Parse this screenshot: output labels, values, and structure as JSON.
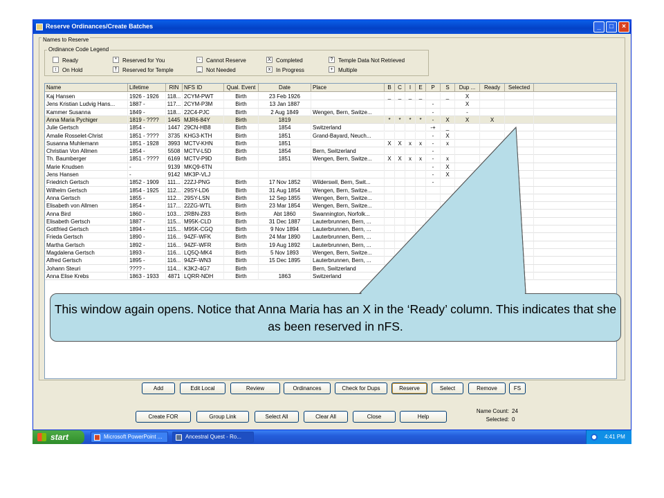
{
  "window": {
    "title": "Reserve Ordinances/Create Batches",
    "minimize": "_",
    "maximize": "□",
    "close": "×"
  },
  "group_label": "Names to Reserve",
  "legend": {
    "title": "Ordinance Code Legend",
    "items": [
      {
        "code": "",
        "label": "Ready"
      },
      {
        "code": "*",
        "label": "Reserved for You"
      },
      {
        "code": "-",
        "label": "Cannot Reserve"
      },
      {
        "code": "X",
        "label": "Completed"
      },
      {
        "code": "?",
        "label": "Temple Data Not Retrieved"
      },
      {
        "code": "↕",
        "label": "On Hold"
      },
      {
        "code": "†",
        "label": "Reserved for Temple"
      },
      {
        "code": "_",
        "label": "Not Needed"
      },
      {
        "code": "x",
        "label": "In Progress"
      },
      {
        "code": "+",
        "label": "Multiple"
      }
    ]
  },
  "columns": [
    "Name",
    "Lifetime",
    "RIN",
    "NFS ID",
    "Qual. Event",
    "Date",
    "Place",
    "B",
    "C",
    "I",
    "E",
    "P",
    "S",
    "Dup ...",
    "Ready",
    "Selected"
  ],
  "rows": [
    [
      "Kaj Hansen",
      "1926 - 1926",
      "118...",
      "2CYM-PWT",
      "Birth",
      "23 Feb 1926",
      "",
      "_",
      "_",
      "_",
      "_",
      "",
      "_",
      "X",
      "",
      ""
    ],
    [
      "Jens Kristian Ludvig Hans...",
      "1887 -",
      "117...",
      "2CYM-P3M",
      "Birth",
      "13 Jan 1887",
      "",
      "",
      "",
      "",
      "",
      "-",
      "",
      "X",
      "",
      ""
    ],
    [
      "Kammer Susanna",
      "1849 -",
      "118...",
      "22C4-PJC",
      "Birth",
      "2 Aug 1849",
      "Wengen, Bern, Switze...",
      "",
      "",
      "",
      "",
      "-",
      "",
      "-",
      "",
      ""
    ],
    [
      "Anna Maria Pychiger",
      "1819 - ????",
      "1445",
      "MJR6-84Y",
      "Birth",
      "1819",
      "",
      "*",
      "*",
      "*",
      "*",
      "-",
      "X",
      "X",
      "X",
      ""
    ],
    [
      "Julie Gertsch",
      "1854 -",
      "1447",
      "29CN-HB8",
      "Birth",
      "1854",
      "Switzerland",
      "",
      "",
      "",
      "",
      "-+",
      "_",
      "",
      "",
      ""
    ],
    [
      "Amalie Rosselet-Christ",
      "1851 - ????",
      "3735",
      "KHG3-KTH",
      "Birth",
      "1851",
      "Grand-Bayard, Neuch...",
      "",
      "",
      "",
      "",
      "-",
      "X",
      "",
      "",
      ""
    ],
    [
      "Susanna Muhlemann",
      "1851 - 1928",
      "3993",
      "MCTV-KHN",
      "Birth",
      "1851",
      "",
      "X",
      "X",
      "x",
      "x",
      "-",
      "x",
      "",
      "",
      ""
    ],
    [
      "Christian Von Allmen",
      "1854 -",
      "5508",
      "MCTV-L5D",
      "Birth",
      "1854",
      "Bern, Switzerland",
      "",
      "",
      "",
      "",
      "-",
      "",
      "",
      "",
      ""
    ],
    [
      "Th. Baumberger",
      "1851 - ????",
      "6169",
      "MCTV-P9D",
      "Birth",
      "1851",
      "Wengen, Bern, Switze...",
      "X",
      "X",
      "x",
      "x",
      "-",
      "x",
      "",
      "",
      ""
    ],
    [
      "Marie Knudsen",
      "-",
      "9139",
      "MKQ9-6TN",
      "",
      "",
      "",
      "",
      "",
      "",
      "",
      "-",
      "X",
      "",
      "",
      ""
    ],
    [
      "Jens Hansen",
      "-",
      "9142",
      "MK3P-VLJ",
      "",
      "",
      "",
      "",
      "",
      "",
      "",
      "-",
      "X",
      "",
      "",
      ""
    ],
    [
      "Friedrich Gertsch",
      "1852 - 1909",
      "111...",
      "22ZJ-PNG",
      "Birth",
      "17 Nov 1852",
      "Wilderswil, Bern, Swit...",
      "",
      "",
      "",
      "",
      "-",
      "",
      "",
      "",
      ""
    ],
    [
      "Wilhelm Gertsch",
      "1854 - 1925",
      "112...",
      "29SY-LD6",
      "Birth",
      "31 Aug 1854",
      "Wengen, Bern, Switze...",
      "",
      "",
      "",
      "",
      "",
      "",
      "",
      "",
      ""
    ],
    [
      "Anna Gertsch",
      "1855 -",
      "112...",
      "29SY-LSN",
      "Birth",
      "12 Sep 1855",
      "Wengen, Bern, Switze...",
      "",
      "",
      "",
      "",
      "",
      "",
      "",
      "",
      ""
    ],
    [
      "Elisabeth von Allmen",
      "1854 -",
      "117...",
      "22ZG-WTL",
      "Birth",
      "23 Mar 1854",
      "Wengen, Bern, Switze...",
      "",
      "",
      "",
      "",
      "",
      "",
      "",
      "",
      ""
    ],
    [
      "Anna Bird",
      "1860 -",
      "103...",
      "2RBN-Z83",
      "Birth",
      "Abt 1860",
      "Swannington, Norfolk...",
      "",
      "",
      "",
      "",
      "",
      "",
      "",
      "",
      ""
    ],
    [
      "Elisabeth Gertsch",
      "1887 -",
      "115...",
      "M95K-CLD",
      "Birth",
      "31 Dec 1887",
      "Lauterbrunnen, Bern, ...",
      "",
      "",
      "",
      "",
      "",
      "",
      "",
      "",
      ""
    ],
    [
      "Gottfried Gertsch",
      "1894 -",
      "115...",
      "M95K-CGQ",
      "Birth",
      "9 Nov 1894",
      "Lauterbrunnen, Bern, ...",
      "",
      "",
      "",
      "",
      "",
      "",
      "",
      "",
      ""
    ],
    [
      "Frieda Gertsch",
      "1890 -",
      "116...",
      "94ZF-WFK",
      "Birth",
      "24 Mar 1890",
      "Lauterbrunnen, Bern, ...",
      "",
      "",
      "",
      "",
      "",
      "",
      "",
      "",
      ""
    ],
    [
      "Martha Gertsch",
      "1892 -",
      "116...",
      "94ZF-WFR",
      "Birth",
      "19 Aug 1892",
      "Lauterbrunnen, Bern, ...",
      "",
      "",
      "",
      "",
      "",
      "",
      "",
      "",
      ""
    ],
    [
      "Magdalena Gertsch",
      "1893 -",
      "116...",
      "LQ5Q-MK4",
      "Birth",
      "5 Nov 1893",
      "Wengen, Bern, Switze...",
      "",
      "",
      "",
      "",
      "",
      "",
      "",
      "",
      ""
    ],
    [
      "Alfred Gertsch",
      "1895 -",
      "116...",
      "94ZF-WN3",
      "Birth",
      "15 Dec 1895",
      "Lauterbrunnen, Bern, ...",
      "",
      "",
      "",
      "",
      "",
      "",
      "",
      "",
      ""
    ],
    [
      "Johann Steuri",
      "???? -",
      "114...",
      "K3K2-4G7",
      "Birth",
      "",
      "Bern, Switzerland",
      "",
      "",
      "",
      "",
      "",
      "",
      "",
      "",
      ""
    ],
    [
      "Anna Elise Krebs",
      "1863 - 1933",
      "4871",
      "LQRR-NDH",
      "Birth",
      "1863",
      "Switzerland",
      "",
      "",
      "",
      "",
      "",
      "",
      "",
      "",
      ""
    ]
  ],
  "buttons_row1": [
    "Add",
    "Edit Local",
    "Review",
    "Ordinances",
    "Check for Dups",
    "Reserve",
    "Select",
    "Remove",
    "FS"
  ],
  "buttons_row2": [
    "Create FOR",
    "Group Link",
    "Select All",
    "Clear All",
    "Close",
    "Help"
  ],
  "status": {
    "name_count_label": "Name Count:",
    "name_count": "24",
    "selected_label": "Selected:",
    "selected": "0"
  },
  "taskbar": {
    "start": "start",
    "tasks": [
      "Microsoft PowerPoint ...",
      "Ancestral Quest - Ro..."
    ],
    "time": "4:41 PM"
  },
  "callout": "This window again opens.  Notice that Anna Maria has an X in the ‘Ready’ column.  This indicates that she as been reserved in nFS."
}
